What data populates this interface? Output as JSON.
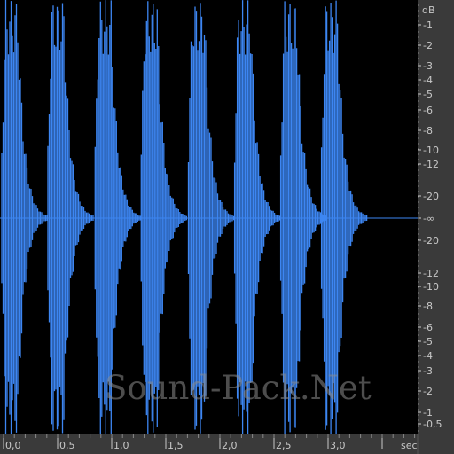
{
  "colors": {
    "waveform": "#3d86f2",
    "background": "#000000",
    "ruler_bg": "#3a3a3a",
    "ruler_text": "#c8c8c8"
  },
  "db_ruler": {
    "unit": "dB",
    "top_labels": [
      "-1",
      "-2",
      "-3",
      "-4",
      "-5",
      "-6",
      "-8",
      "-10",
      "-12",
      "-20"
    ],
    "center_label": "-∞",
    "bottom_labels": [
      "-20",
      "-12",
      "-10",
      "-8",
      "-6",
      "-5",
      "-4",
      "-3",
      "-2",
      "-1",
      "-0,5"
    ]
  },
  "time_ruler": {
    "unit": "sec",
    "labels": [
      "0,0",
      "0,5",
      "1,0",
      "1,5",
      "2,0",
      "2,5",
      "3,0"
    ]
  },
  "waveform": {
    "bursts": 8,
    "transient_times_sec": [
      0.0,
      0.43,
      0.87,
      1.3,
      1.74,
      2.17,
      2.6,
      2.98
    ]
  },
  "watermark": "Sound-Pack.Net"
}
